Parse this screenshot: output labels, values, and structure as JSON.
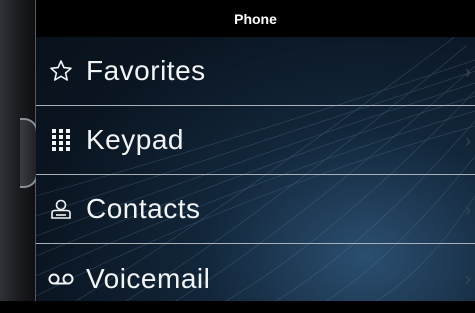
{
  "header": {
    "title": "Phone"
  },
  "menu": {
    "items": [
      {
        "label": "Favorites",
        "icon": "star-outline-icon"
      },
      {
        "label": "Keypad",
        "icon": "keypad-grid-icon"
      },
      {
        "label": "Contacts",
        "icon": "contact-card-icon"
      },
      {
        "label": "Voicemail",
        "icon": "voicemail-icon"
      }
    ]
  },
  "colors": {
    "title_bar": "#000000",
    "text": "#f2f4f6",
    "divider": "#a9b0b8",
    "screen_bg": "#0a1521"
  }
}
